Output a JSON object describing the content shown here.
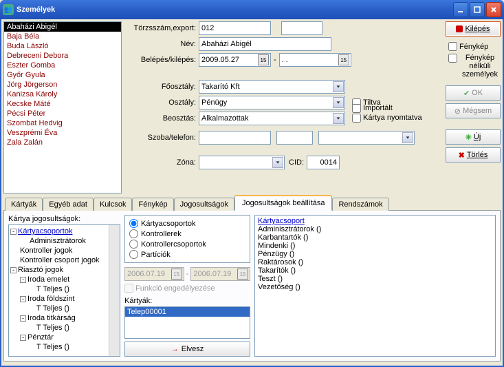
{
  "window": {
    "title": "Személyek"
  },
  "persons": [
    "Abaházi Abigél",
    "Baja Béla",
    "Buda László",
    "Debreceni Debora",
    "Eszter Gomba",
    "Győr Gyula",
    "Jörg Jörgerson",
    "Kanizsa Károly",
    "Kecske Máté",
    "Pécsi Péter",
    "Szombat Hedvig",
    "Veszprémi Éva",
    "Zala Zalán"
  ],
  "form": {
    "torzs_label": "Törzsszám,export:",
    "torzs_value": "012",
    "nev_label": "Név:",
    "nev_value": "Abaházi Abigél",
    "belep_label": "Belépés/kilépés:",
    "belep_value": "2009.05.27",
    "kilep_value": ".  .",
    "foosztaly_label": "Főosztály:",
    "foosztaly_value": "Takarító Kft",
    "osztaly_label": "Osztály:",
    "osztaly_value": "Pénügy",
    "beosztas_label": "Beosztás:",
    "beosztas_value": "Alkalmazottak",
    "szoba_label": "Szoba/telefon:",
    "zona_label": "Zóna:",
    "cid_label": "CID:",
    "cid_value": "0014",
    "chk_tiltva": "Tiltva",
    "chk_importalt": "Importált",
    "chk_kartya": "Kártya nyomtatva"
  },
  "buttons": {
    "kilepes": "Kilépés",
    "fenykep": "Fénykép",
    "fenykep_nelkuli": "Fénykép nélküli személyek",
    "ok": "OK",
    "megsem": "Mégsem",
    "uj": "Új",
    "torles": "Törlés"
  },
  "tabs": [
    "Kártyák",
    "Egyéb adat",
    "Kulcsok",
    "Fénykép",
    "Jogosultságok",
    "Jogosultságok beállítása",
    "Rendszámok"
  ],
  "panel": {
    "heading": "Kártya jogosultságok:",
    "tree": {
      "root": "Kártyacsoportok",
      "admin": "Adminisztrátorok",
      "kj": "Kontroller jogok",
      "kcj": "Kontroller csoport jogok",
      "rj": "Riasztó jogok",
      "ie": "Iroda emelet",
      "tt": "T Teljes ()",
      "if": "Iroda földszint",
      "it": "Iroda titkárság",
      "pz": "Pénztár"
    },
    "radios": {
      "kcs": "Kártyacsoportok",
      "kon": "Kontrollerek",
      "koncs": "Kontrollercsoportok",
      "par": "Partíciók"
    },
    "date1": "2006.07.19",
    "date2": "2006.07.19",
    "func": "Funkció engedélyezése",
    "kartyak_label": "Kártyák:",
    "card": "Telep00001",
    "elvesz": "Elvesz",
    "group_heading": "Kártyacsoport",
    "groups": [
      "Adminisztrátorok ()",
      "Karbantartók ()",
      "Mindenki ()",
      "Pénzügy ()",
      "Raktárosok ()",
      "Takarítók ()",
      "Teszt ()",
      "Vezetőség ()"
    ]
  }
}
